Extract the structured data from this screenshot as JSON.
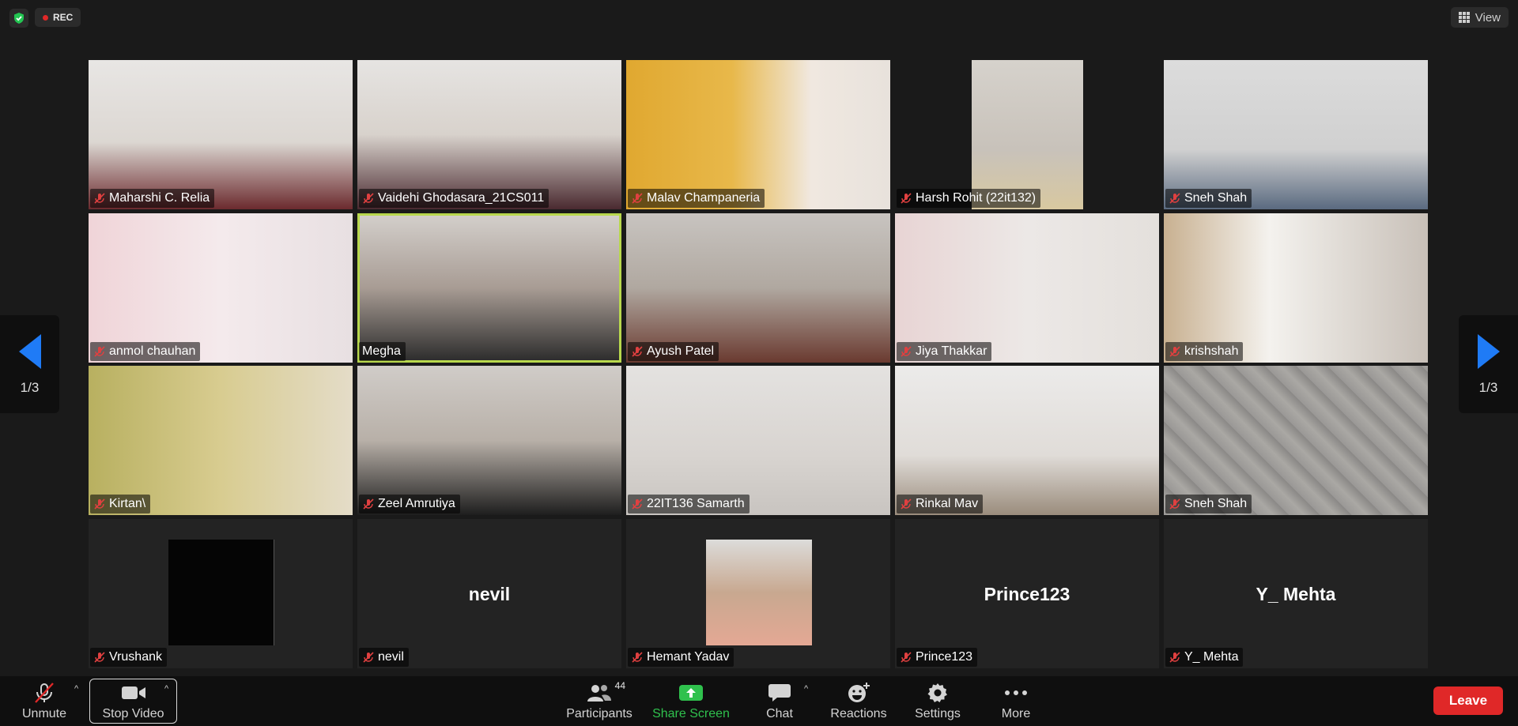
{
  "status": {
    "rec_label": "REC",
    "view_label": "View"
  },
  "pagination": {
    "left": "1/3",
    "right": "1/3"
  },
  "participants": [
    {
      "name": "Maharshi C. Relia",
      "muted": true
    },
    {
      "name": "Vaidehi Ghodasara_21CS011",
      "muted": true
    },
    {
      "name": "Malav Champaneria",
      "muted": true
    },
    {
      "name": "Harsh Rohit (22it132)",
      "muted": true
    },
    {
      "name": "Sneh Shah",
      "muted": true
    },
    {
      "name": "anmol chauhan",
      "muted": true
    },
    {
      "name": "Megha",
      "muted": false,
      "active_speaker": true
    },
    {
      "name": "Ayush Patel",
      "muted": true
    },
    {
      "name": "Jiya Thakkar",
      "muted": true
    },
    {
      "name": "krishshah",
      "muted": true
    },
    {
      "name": "Kirtan\\",
      "muted": true
    },
    {
      "name": "Zeel Amrutiya",
      "muted": true
    },
    {
      "name": "22IT136 Samarth",
      "muted": true
    },
    {
      "name": "Rinkal Mav",
      "muted": true
    },
    {
      "name": "Sneh Shah",
      "muted": true
    },
    {
      "name": "Vrushank",
      "muted": true
    },
    {
      "name": "nevil",
      "muted": true,
      "display_text": "nevil"
    },
    {
      "name": "Hemant Yadav",
      "muted": true
    },
    {
      "name": "Prince123",
      "muted": true,
      "display_text": "Prince123"
    },
    {
      "name": "Y_ Mehta",
      "muted": true,
      "display_text": "Y_ Mehta"
    }
  ],
  "toolbar": {
    "unmute": "Unmute",
    "stop_video": "Stop Video",
    "participants": "Participants",
    "participants_count": "44",
    "share_screen": "Share Screen",
    "chat": "Chat",
    "reactions": "Reactions",
    "settings": "Settings",
    "more": "More",
    "leave": "Leave"
  },
  "colors": {
    "share_green": "#2fc14d",
    "leave_red": "#e02828",
    "active_outline": "#b8d84d",
    "toolbar_bg": "#0f0f0f"
  }
}
